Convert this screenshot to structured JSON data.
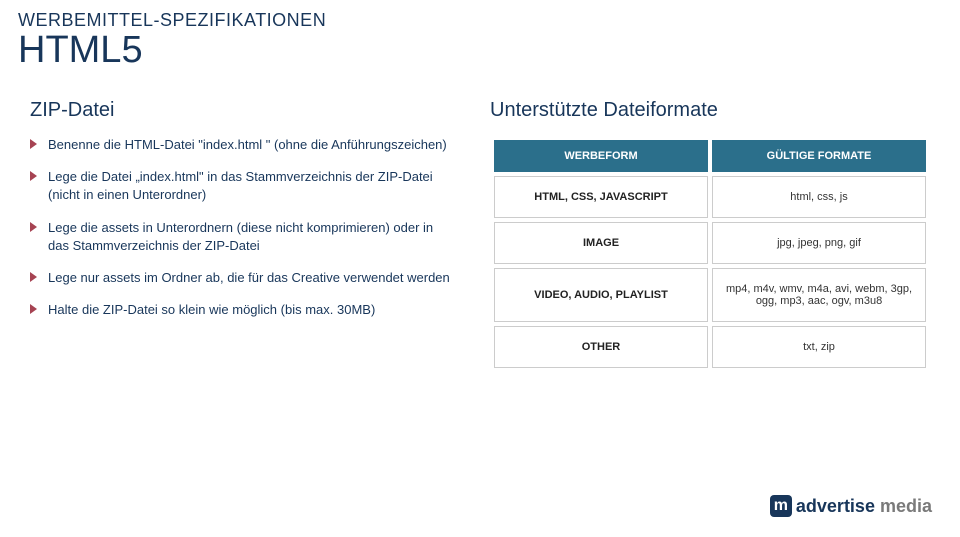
{
  "header": {
    "sub": "WERBEMITTEL-SPEZIFIKATIONEN",
    "main": "HTML5"
  },
  "left": {
    "title": "ZIP-Datei",
    "bullets": [
      "Benenne die HTML-Datei \"index.html \" (ohne die Anführungszeichen)",
      "Lege die Datei „index.html\" in das Stammverzeichnis der ZIP-Datei (nicht in einen Unterordner)",
      "Lege die assets in Unterordnern (diese nicht komprimieren) oder in das Stammverzeichnis der ZIP-Datei",
      "Lege nur assets im Ordner ab, die für das Creative verwendet werden",
      "Halte die ZIP-Datei so klein wie möglich (bis max. 30MB)"
    ]
  },
  "right": {
    "title": "Unterstützte Dateiformate",
    "header1": "WERBEFORM",
    "header2": "GÜLTIGE FORMATE",
    "rows": [
      {
        "form": "HTML, CSS, JAVASCRIPT",
        "formats": "html, css, js"
      },
      {
        "form": "IMAGE",
        "formats": "jpg, jpeg, png, gif"
      },
      {
        "form": "VIDEO, AUDIO, PLAYLIST",
        "formats": "mp4, m4v, wmv, m4a, avi, webm, 3gp, ogg, mp3, aac, ogv, m3u8"
      },
      {
        "form": "OTHER",
        "formats": "txt, zip"
      }
    ]
  },
  "logo": {
    "box": "m",
    "brand": "advertise",
    "suffix": " media"
  }
}
